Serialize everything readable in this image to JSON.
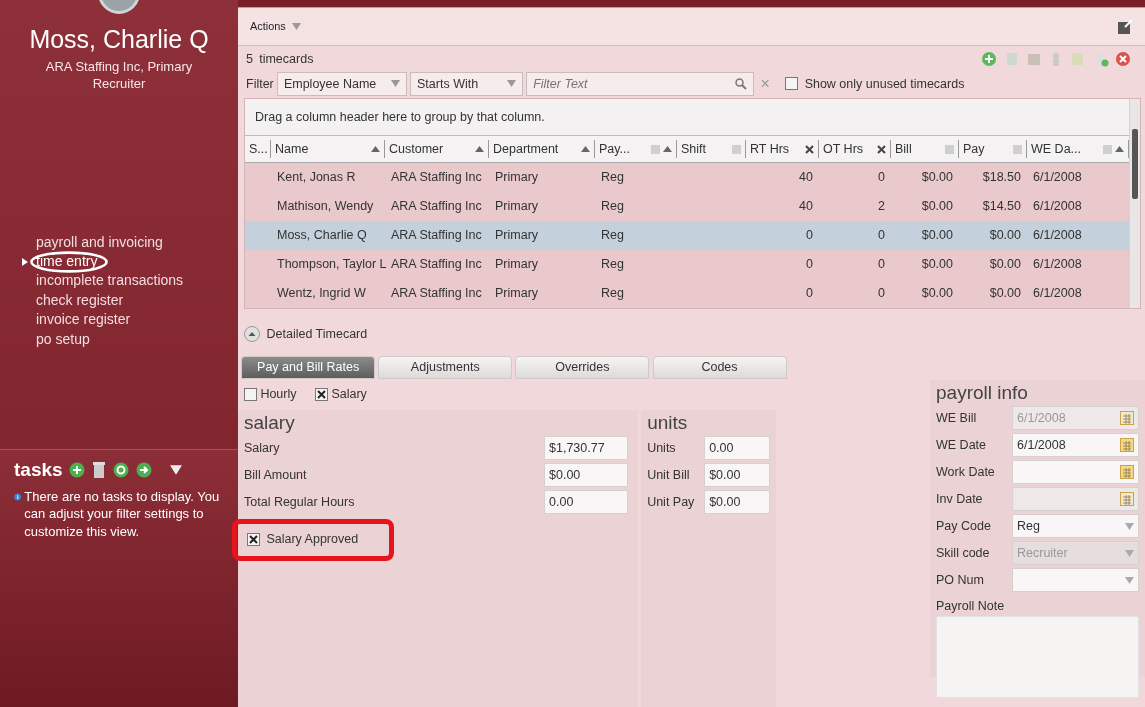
{
  "user": {
    "name": "Moss, Charlie Q",
    "subtitle": "ARA Staffing Inc, Primary Recruiter"
  },
  "nav": [
    {
      "label": "payroll and invoicing",
      "selected": false
    },
    {
      "label": "time entry",
      "selected": true
    },
    {
      "label": "incomplete transactions",
      "selected": false
    },
    {
      "label": "check register",
      "selected": false
    },
    {
      "label": "invoice register",
      "selected": false
    },
    {
      "label": "po setup",
      "selected": false
    }
  ],
  "tasks": {
    "title": "tasks",
    "message": "There are no tasks to display. You can adjust your filter settings to customize this view."
  },
  "actions": {
    "label": "Actions"
  },
  "list": {
    "count": "5",
    "count_label": "timecards",
    "filter": {
      "label": "Filter",
      "field": "Employee Name",
      "operator": "Starts With",
      "placeholder": "Filter Text",
      "clear": "×",
      "unused_label": "Show only unused timecards",
      "unused_checked": false
    },
    "group_hint": "Drag a column header here to group by that column.",
    "columns": [
      {
        "label": "S...",
        "kind": "text",
        "sort": false,
        "filter": false,
        "filtered": false
      },
      {
        "label": "Name",
        "kind": "text",
        "sort": true,
        "filter": false,
        "filtered": false
      },
      {
        "label": "Customer",
        "kind": "text",
        "sort": true,
        "filter": false,
        "filtered": false
      },
      {
        "label": "Department",
        "kind": "text",
        "sort": true,
        "filter": false,
        "filtered": false
      },
      {
        "label": "Pay...",
        "kind": "text",
        "sort": true,
        "filter": true,
        "filtered": false
      },
      {
        "label": "Shift",
        "kind": "text",
        "sort": false,
        "filter": true,
        "filtered": false
      },
      {
        "label": "RT Hrs",
        "kind": "number",
        "sort": false,
        "filter": true,
        "filtered": true
      },
      {
        "label": "OT Hrs",
        "kind": "number",
        "sort": false,
        "filter": true,
        "filtered": true
      },
      {
        "label": "Bill",
        "kind": "number",
        "sort": false,
        "filter": true,
        "filtered": false
      },
      {
        "label": "Pay",
        "kind": "number",
        "sort": false,
        "filter": true,
        "filtered": false
      },
      {
        "label": "WE Da...",
        "kind": "text",
        "sort": true,
        "filter": true,
        "filtered": false
      }
    ],
    "rows": [
      {
        "selected": false,
        "cells": [
          "",
          "Kent, Jonas R",
          "ARA Staffing Inc",
          "Primary",
          "Reg",
          "",
          "40",
          "0",
          "$0.00",
          "$18.50",
          "6/1/2008"
        ]
      },
      {
        "selected": false,
        "cells": [
          "",
          "Mathison, Wendy",
          "ARA Staffing Inc",
          "Primary",
          "Reg",
          "",
          "40",
          "2",
          "$0.00",
          "$14.50",
          "6/1/2008"
        ]
      },
      {
        "selected": true,
        "cells": [
          "",
          "Moss, Charlie Q",
          "ARA Staffing Inc",
          "Primary",
          "Reg",
          "",
          "0",
          "0",
          "$0.00",
          "$0.00",
          "6/1/2008"
        ]
      },
      {
        "selected": false,
        "cells": [
          "",
          "Thompson, Taylor L",
          "ARA Staffing Inc",
          "Primary",
          "Reg",
          "",
          "0",
          "0",
          "$0.00",
          "$0.00",
          "6/1/2008"
        ]
      },
      {
        "selected": false,
        "cells": [
          "",
          "Wentz, Ingrid W",
          "ARA Staffing Inc",
          "Primary",
          "Reg",
          "",
          "0",
          "0",
          "$0.00",
          "$0.00",
          "6/1/2008"
        ]
      }
    ]
  },
  "detail": {
    "title": "Detailed Timecard",
    "expanded": true,
    "tabs": [
      {
        "label": "Pay and Bill Rates",
        "selected": true
      },
      {
        "label": "Adjustments",
        "selected": false
      },
      {
        "label": "Overrides",
        "selected": false
      },
      {
        "label": "Codes",
        "selected": false
      }
    ],
    "modes": [
      {
        "label": "Hourly",
        "checked": false
      },
      {
        "label": "Salary",
        "checked": true
      }
    ],
    "salary": {
      "title": "salary",
      "fields": [
        {
          "label": "Salary",
          "value": "$1,730.77"
        },
        {
          "label": "Bill Amount",
          "value": "$0.00"
        },
        {
          "label": "Total Regular Hours",
          "value": "0.00"
        }
      ],
      "approved": {
        "label": "Salary Approved",
        "checked": true
      }
    },
    "units": {
      "title": "units",
      "fields": [
        {
          "label": "Units",
          "value": "0.00"
        },
        {
          "label": "Unit Bill",
          "value": "$0.00"
        },
        {
          "label": "Unit Pay",
          "value": "$0.00"
        }
      ]
    },
    "payroll": {
      "title": "payroll info",
      "fields": [
        {
          "label": "WE Bill",
          "kind": "date",
          "value": "6/1/2008",
          "disabled": true
        },
        {
          "label": "WE Date",
          "kind": "date",
          "value": "6/1/2008",
          "disabled": false
        },
        {
          "label": "Work Date",
          "kind": "date",
          "disabled": false
        },
        {
          "label": "Inv Date",
          "kind": "date",
          "disabled": true
        },
        {
          "label": "Pay Code",
          "kind": "select",
          "value": "Reg",
          "disabled": false
        },
        {
          "label": "Skill code",
          "kind": "select",
          "value": "Recruiter",
          "disabled": true
        },
        {
          "label": "PO Num",
          "kind": "select",
          "disabled": false
        }
      ],
      "note_label": "Payroll Note"
    }
  }
}
